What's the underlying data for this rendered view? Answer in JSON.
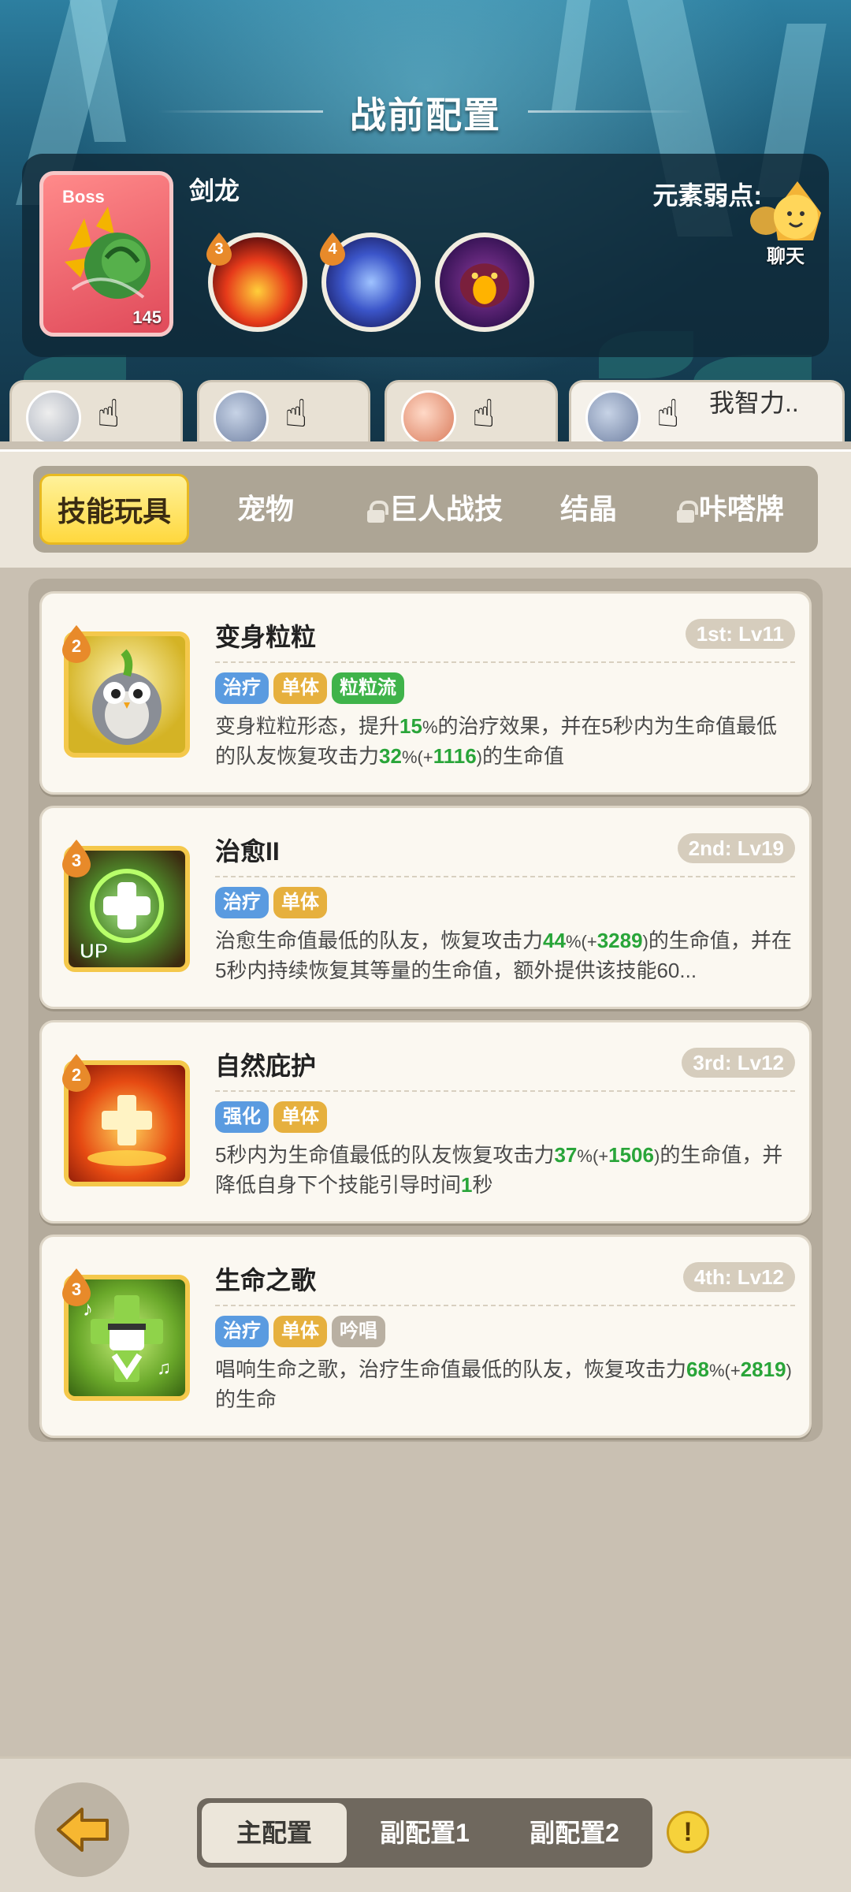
{
  "page_title": "战前配置",
  "boss": {
    "tag": "Boss",
    "name": "剑龙",
    "level": "145",
    "weakness_label": "元素弱点:",
    "skills": [
      {
        "badge": "3",
        "icon": "fire-swirl-icon"
      },
      {
        "badge": "4",
        "icon": "water-swirl-icon"
      },
      {
        "badge": "",
        "icon": "roaring-beast-icon"
      }
    ]
  },
  "chat": {
    "label": "聊天"
  },
  "heroes": [
    {
      "name": "",
      "icon": "hero-avatar-icon"
    },
    {
      "name": "",
      "icon": "hero-avatar-icon"
    },
    {
      "name": "",
      "icon": "hero-avatar-icon"
    },
    {
      "name": "我智力..",
      "icon": "hero-avatar-icon"
    }
  ],
  "categories": [
    {
      "label": "技能玩具",
      "locked": false
    },
    {
      "label": "宠物",
      "locked": false
    },
    {
      "label": "巨人战技",
      "locked": true
    },
    {
      "label": "结晶",
      "locked": false
    },
    {
      "label": "咔嗒牌",
      "locked": true
    }
  ],
  "skills": [
    {
      "name": "变身粒粒",
      "order": "1st: Lv11",
      "level_badge": "2",
      "icon": "owl-icon",
      "tags": [
        {
          "label": "治疗",
          "color": "blue"
        },
        {
          "label": "单体",
          "color": "gold"
        },
        {
          "label": "粒粒流",
          "color": "green"
        }
      ],
      "desc": [
        {
          "t": "变身粒粒形态，提升"
        },
        {
          "t": "15",
          "g": true
        },
        {
          "t": "%",
          "s": true
        },
        {
          "t": "的治疗效果，并在5秒内为生命值最低的队友恢复攻击力"
        },
        {
          "t": "32",
          "g": true
        },
        {
          "t": "%(+",
          "s": true
        },
        {
          "t": "1116",
          "g": true
        },
        {
          "t": ")",
          "s": true
        },
        {
          "t": "的生命值"
        }
      ]
    },
    {
      "name": "治愈II",
      "order": "2nd: Lv19",
      "level_badge": "3",
      "icon": "heal-cross-up-icon",
      "up_label": "UP",
      "tags": [
        {
          "label": "治疗",
          "color": "blue"
        },
        {
          "label": "单体",
          "color": "gold"
        }
      ],
      "desc": [
        {
          "t": "治愈生命值最低的队友，恢复攻击力"
        },
        {
          "t": "44",
          "g": true
        },
        {
          "t": "%(+",
          "s": true
        },
        {
          "t": "3289",
          "g": true
        },
        {
          "t": ")",
          "s": true
        },
        {
          "t": "的生命值，并在5秒内持续恢复其等量的生命值，额外提供该技能60..."
        }
      ]
    },
    {
      "name": "自然庇护",
      "order": "3rd: Lv12",
      "level_badge": "2",
      "icon": "shield-cross-icon",
      "tags": [
        {
          "label": "强化",
          "color": "blue"
        },
        {
          "label": "单体",
          "color": "gold"
        }
      ],
      "desc": [
        {
          "t": "5秒内为生命值最低的队友恢复攻击力"
        },
        {
          "t": "37",
          "g": true
        },
        {
          "t": "%(+",
          "s": true
        },
        {
          "t": "1506",
          "g": true
        },
        {
          "t": ")",
          "s": true
        },
        {
          "t": "的生命值，并降低自身下个技能引导时间"
        },
        {
          "t": "1",
          "g": true
        },
        {
          "t": "秒"
        }
      ]
    },
    {
      "name": "生命之歌",
      "order": "4th: Lv12",
      "level_badge": "3",
      "icon": "singing-cross-icon",
      "tags": [
        {
          "label": "治疗",
          "color": "blue"
        },
        {
          "label": "单体",
          "color": "gold"
        },
        {
          "label": "吟唱",
          "color": "grey"
        }
      ],
      "desc": [
        {
          "t": "唱响生命之歌，治疗生命值最低的队友，恢复攻击力"
        },
        {
          "t": "68",
          "g": true
        },
        {
          "t": "%(+",
          "s": true
        },
        {
          "t": "2819",
          "g": true
        },
        {
          "t": ")",
          "s": true
        },
        {
          "t": "的生命"
        }
      ]
    }
  ],
  "configs": [
    {
      "label": "主配置",
      "active": true
    },
    {
      "label": "副配置1",
      "active": false
    },
    {
      "label": "副配置2",
      "active": false
    }
  ],
  "warning": {
    "label": "!"
  },
  "colors": {
    "accent": "#ffd83e",
    "heal_green": "#29a539",
    "tag_blue": "#5a9be0",
    "tag_gold": "#e6b03e"
  }
}
